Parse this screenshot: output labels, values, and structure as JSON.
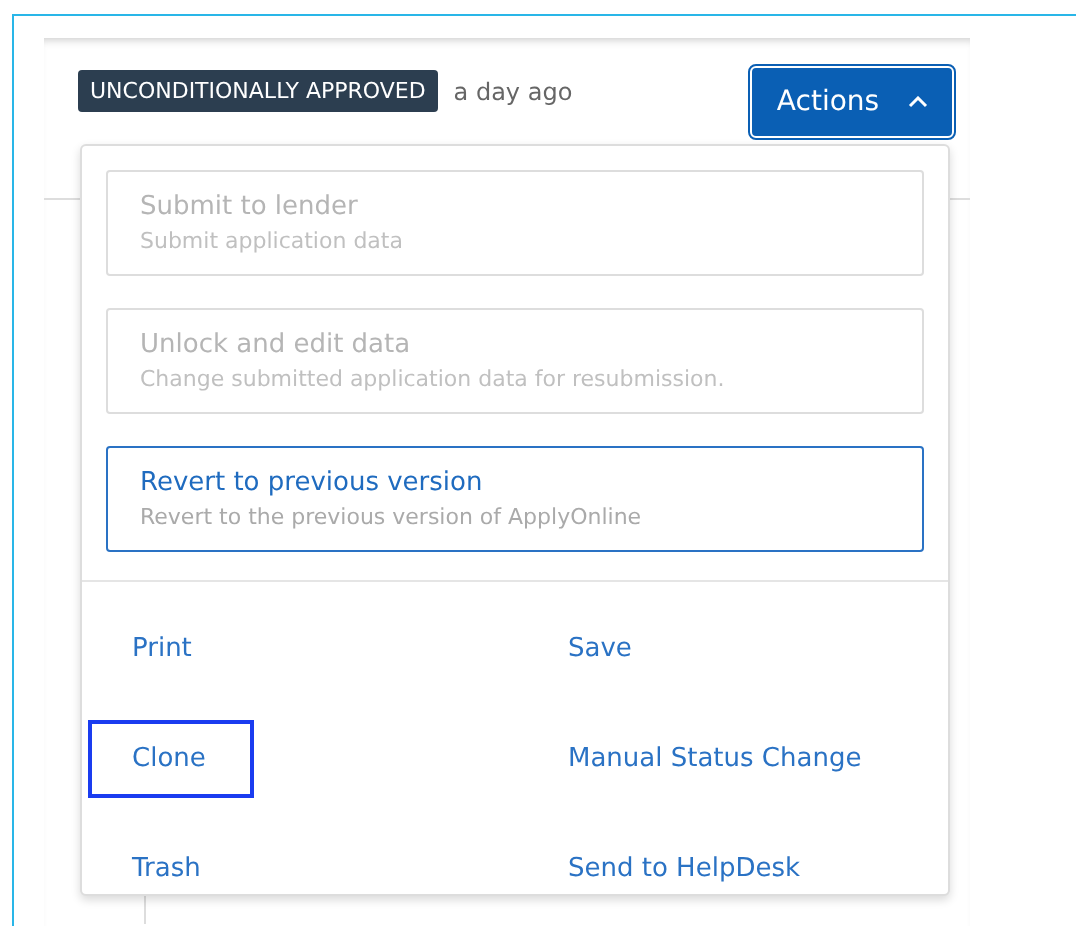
{
  "status_badge": "UNCONDITIONALLY APPROVED",
  "timestamp": "a day ago",
  "actions_button": {
    "label": "Actions",
    "expanded": true
  },
  "action_cards": [
    {
      "title": "Submit to lender",
      "description": "Submit application data",
      "disabled": true,
      "focused": false
    },
    {
      "title": "Unlock and edit data",
      "description": "Change submitted application data for resubmission.",
      "disabled": true,
      "focused": false
    },
    {
      "title": "Revert to previous version",
      "description": "Revert to the previous version of ApplyOnline",
      "disabled": false,
      "focused": true
    }
  ],
  "links": [
    {
      "label": "Print",
      "focused": false
    },
    {
      "label": "Save",
      "focused": false
    },
    {
      "label": "Clone",
      "focused": true
    },
    {
      "label": "Manual Status Change",
      "focused": false
    },
    {
      "label": "Trash",
      "focused": false
    },
    {
      "label": "Send to HelpDesk",
      "focused": false
    }
  ]
}
